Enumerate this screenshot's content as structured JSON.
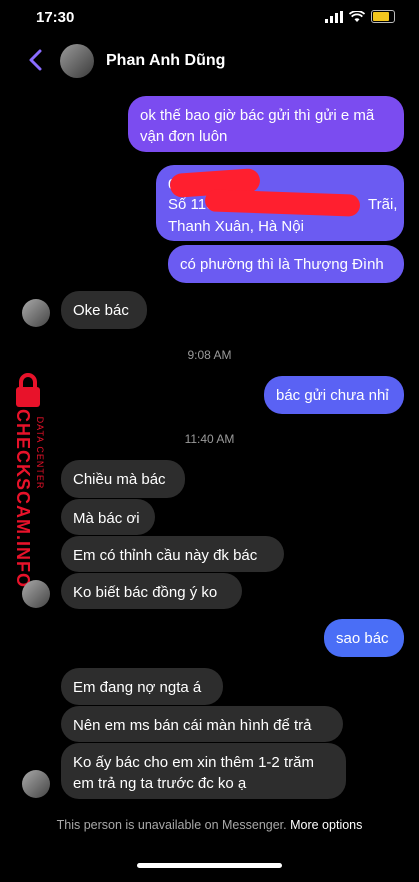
{
  "status": {
    "time": "17:30",
    "battery_color": "#f2c61f",
    "battery_level": 0.8
  },
  "header": {
    "contact_name": "Phan Anh Dũng"
  },
  "messages": {
    "m1": "ok thế bao giờ bác gửi thì gửi e mã\nvận đơn luôn",
    "m2a": "0965",
    "m2b": "Số 119 ngu",
    "m2c": "Trãi,",
    "m2d": "Thanh Xuân, Hà Nội",
    "m3": "có phường thì là Thượng Đình",
    "m4": "Oke bác",
    "t1": "9:08 AM",
    "m5": "bác gửi chưa nhỉ",
    "t2": "11:40 AM",
    "m6": "Chiều mà bác",
    "m7": "Mà bác ơi",
    "m8": "Em có thỉnh cầu này đk bác",
    "m9": "Ko biết bác đồng ý ko",
    "m10": "sao bác",
    "m11": "Em đang nợ ngta á",
    "m12": "Nên em ms bán cái màn hình để trả",
    "m13": "Ko ấy bác cho em xin thêm 1-2 trăm\nem trả ng ta trước đc ko ạ"
  },
  "watermark": {
    "brand": "CHECKSCAM.INFO",
    "sub": "DATA CENTER"
  },
  "footer": {
    "text": "This person is unavailable on Messenger.",
    "link": "More options"
  }
}
